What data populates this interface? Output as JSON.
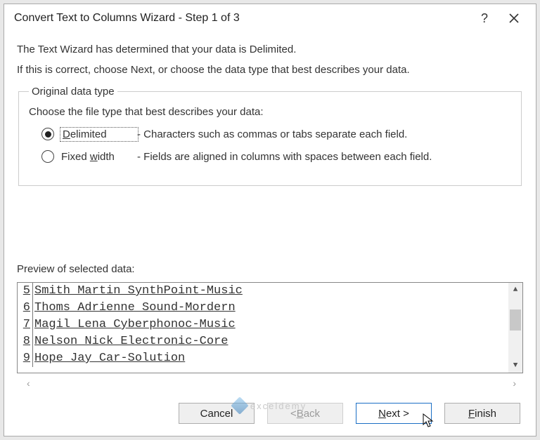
{
  "dialog": {
    "title": "Convert Text to Columns Wizard - Step 1 of 3",
    "intro1": "The Text Wizard has determined that your data is Delimited.",
    "intro2": "If this is correct, choose Next, or choose the data type that best describes your data.",
    "group_legend": "Original data type",
    "choose_line": "Choose the file type that best describes your data:",
    "radios": {
      "delimited": {
        "pre": "",
        "key": "D",
        "post": "elimited",
        "desc": "- Characters such as commas or tabs separate each field."
      },
      "fixed": {
        "pre": "Fixed ",
        "key": "w",
        "post": "idth",
        "desc": "- Fields are aligned in columns with spaces between each field."
      }
    },
    "preview_label": "Preview of selected data:",
    "preview_rows": [
      {
        "n": "5",
        "t": "Smith Martin SynthPoint-Music"
      },
      {
        "n": "6",
        "t": "Thoms Adrienne Sound-Mordern"
      },
      {
        "n": "7",
        "t": "Magil Lena Cyberphonoc-Music"
      },
      {
        "n": "8",
        "t": "Nelson Nick Electronic-Core"
      },
      {
        "n": "9",
        "t": "Hope Jay Car-Solution"
      }
    ],
    "buttons": {
      "cancel": "Cancel",
      "back_pre": "< ",
      "back_key": "B",
      "back_post": "ack",
      "next_key": "N",
      "next_post": "ext >",
      "finish_key": "F",
      "finish_post": "inish"
    },
    "watermark": "exceldemy"
  }
}
